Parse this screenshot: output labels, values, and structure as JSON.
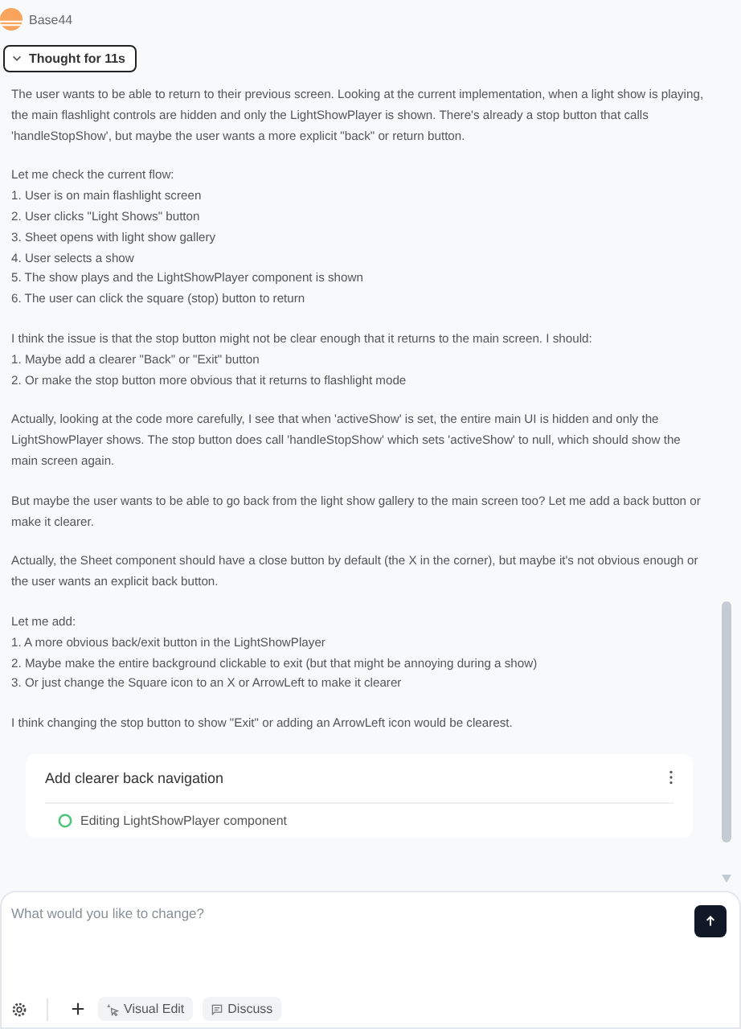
{
  "header": {
    "name": "Base44"
  },
  "thought": {
    "label": "Thought for 11s",
    "expanded": true,
    "paragraphs": [
      [
        "The user wants to be able to return to their previous screen. Looking at the current implementation, when a light show is playing, the main flashlight controls are hidden and only the LightShowPlayer is shown. There's already a stop button that calls 'handleStopShow', but maybe the user wants a more explicit \"back\" or return button."
      ],
      [
        "Let me check the current flow:",
        "1. User is on main flashlight screen",
        "2. User clicks \"Light Shows\" button",
        "3. Sheet opens with light show gallery",
        "4. User selects a show",
        "5. The show plays and the LightShowPlayer component is shown",
        "6. The user can click the square (stop) button to return"
      ],
      [
        "I think the issue is that the stop button might not be clear enough that it returns to the main screen. I should:",
        "1. Maybe add a clearer \"Back\" or \"Exit\" button",
        "2. Or make the stop button more obvious that it returns to flashlight mode"
      ],
      [
        "Actually, looking at the code more carefully, I see that when 'activeShow' is set, the entire main UI is hidden and only the LightShowPlayer shows. The stop button does call 'handleStopShow' which sets 'activeShow' to null, which should show the main screen again."
      ],
      [
        "But maybe the user wants to be able to go back from the light show gallery to the main screen too? Let me add a back button or make it clearer."
      ],
      [
        "Actually, the Sheet component should have a close button by default (the X in the corner), but maybe it's not obvious enough or the user wants an explicit back button."
      ],
      [
        "Let me add:",
        "1. A more obvious back/exit button in the LightShowPlayer",
        "2. Maybe make the entire background clickable to exit (but that might be annoying during a show)",
        "3. Or just change the Square icon to an X or ArrowLeft to make it clearer"
      ],
      [
        "I think changing the stop button to show \"Exit\" or adding an ArrowLeft icon would be clearest."
      ]
    ]
  },
  "task_card": {
    "title": "Add clearer back navigation",
    "steps": [
      {
        "label": "Editing LightShowPlayer component"
      }
    ]
  },
  "composer": {
    "placeholder": "What would you like to change?",
    "tools": [
      {
        "kind": "visual",
        "label": "Visual Edit"
      },
      {
        "kind": "discuss",
        "label": "Discuss"
      }
    ]
  }
}
